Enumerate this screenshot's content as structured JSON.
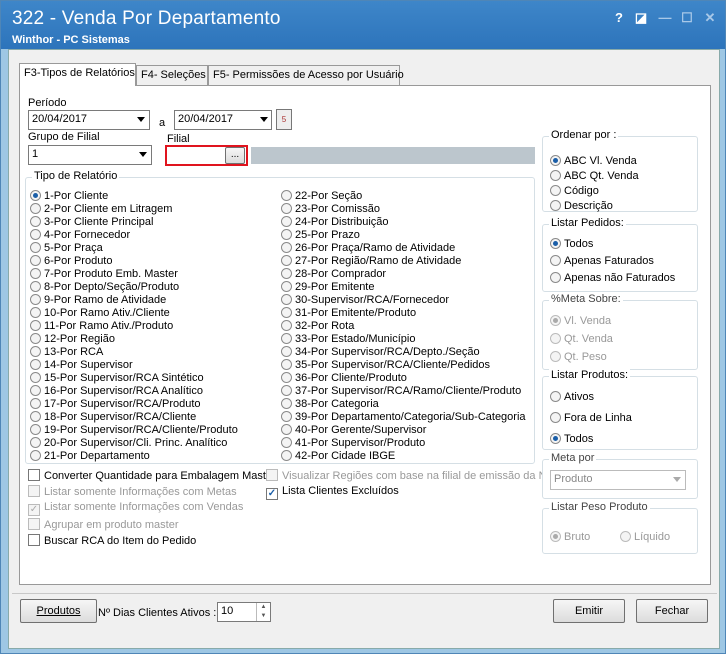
{
  "window": {
    "title": "322 - Venda Por Departamento",
    "subtitle": "Winthor - PC Sistemas",
    "help": "?",
    "restore": "◪",
    "minimize": "—",
    "maximize": "☐",
    "close": "✕"
  },
  "tabs": [
    "F3-Tipos de Relatórios",
    "F4- Seleções",
    "F5- Permissões de Acesso por Usuário"
  ],
  "periodo": {
    "label": "Período",
    "from": "20/04/2017",
    "sep": "a",
    "to": "20/04/2017",
    "calendar": "5"
  },
  "grupo_filial": {
    "label": "Grupo de Filial",
    "value": "1"
  },
  "filial": {
    "label": "Filial",
    "value": "",
    "button": "..."
  },
  "tipo_relatorio": {
    "label": "Tipo de Relatório",
    "col1": [
      "1-Por Cliente",
      "2-Por Cliente em Litragem",
      "3-Por Cliente Principal",
      "4-Por Fornecedor",
      "5-Por Praça",
      "6-Por Produto",
      "7-Por Produto Emb. Master",
      "8-Por Depto/Seção/Produto",
      "9-Por Ramo de Atividade",
      "10-Por Ramo Ativ./Cliente",
      "11-Por Ramo Ativ./Produto",
      "12-Por Região",
      "13-Por RCA",
      "14-Por Supervisor",
      "15-Por Supervisor/RCA Sintético",
      "16-Por Supervisor/RCA Analítico",
      "17-Por Supervisor/RCA/Produto",
      "18-Por Supervisor/RCA/Cliente",
      "19-Por Supervisor/RCA/Cliente/Produto",
      "20-Por Supervisor/Cli. Princ. Analítico",
      "21-Por Departamento"
    ],
    "col2": [
      "22-Por Seção",
      "23-Por Comissão",
      "24-Por Distribuição",
      "25-Por Prazo",
      "26-Por Praça/Ramo de Atividade",
      "27-Por Região/Ramo de Atividade",
      "28-Por Comprador",
      "29-Por Emitente",
      "30-Supervisor/RCA/Fornecedor",
      "31-Por Emitente/Produto",
      "32-Por Rota",
      "33-Por Estado/Município",
      "34-Por Supervisor/RCA/Depto./Seção",
      "35-Por Supervisor/RCA/Cliente/Pedidos",
      "36-Por Cliente/Produto",
      "37-Por Supervisor/RCA/Ramo/Cliente/Produto",
      "38-Por Categoria",
      "39-Por Departamento/Categoria/Sub-Categoria",
      "40-Por Gerente/Supervisor",
      "41-Por Supervisor/Produto",
      "42-Por Cidade IBGE"
    ]
  },
  "checks": {
    "converter": "Converter Quantidade para Embalagem Master",
    "listar_metas": "Listar somente Informações com Metas",
    "listar_vendas": "Listar somente Informações com Vendas",
    "agrupar": "Agrupar em produto master",
    "buscar_rca": "Buscar RCA do Item do Pedido",
    "visualizar": "Visualizar Regiões com base na filial de emissão da NF",
    "lista_excluidos": "Lista Clientes Excluídos",
    "check_mark": "✓"
  },
  "ordenar": {
    "label": "Ordenar por :",
    "options": [
      "ABC Vl. Venda",
      "ABC Qt. Venda",
      "Código",
      "Descrição"
    ]
  },
  "listar_pedidos": {
    "label": "Listar Pedidos:",
    "options": [
      "Todos",
      "Apenas Faturados",
      "Apenas não Faturados"
    ]
  },
  "meta_sobre": {
    "label": "%Meta Sobre:",
    "options": [
      "Vl. Venda",
      "Qt. Venda",
      "Qt. Peso"
    ]
  },
  "listar_produtos": {
    "label": "Listar Produtos:",
    "options": [
      "Ativos",
      "Fora de Linha",
      "Todos"
    ]
  },
  "meta_por": {
    "label": "Meta por",
    "value": "Produto"
  },
  "listar_peso": {
    "label": "Listar Peso Produto",
    "options": [
      "Bruto",
      "Líquido"
    ]
  },
  "footer": {
    "produtos": "Produtos",
    "dias_label": "Nº Dias Clientes Ativos :",
    "dias_value": "10",
    "emitir": "Emitir",
    "fechar": "Fechar"
  }
}
